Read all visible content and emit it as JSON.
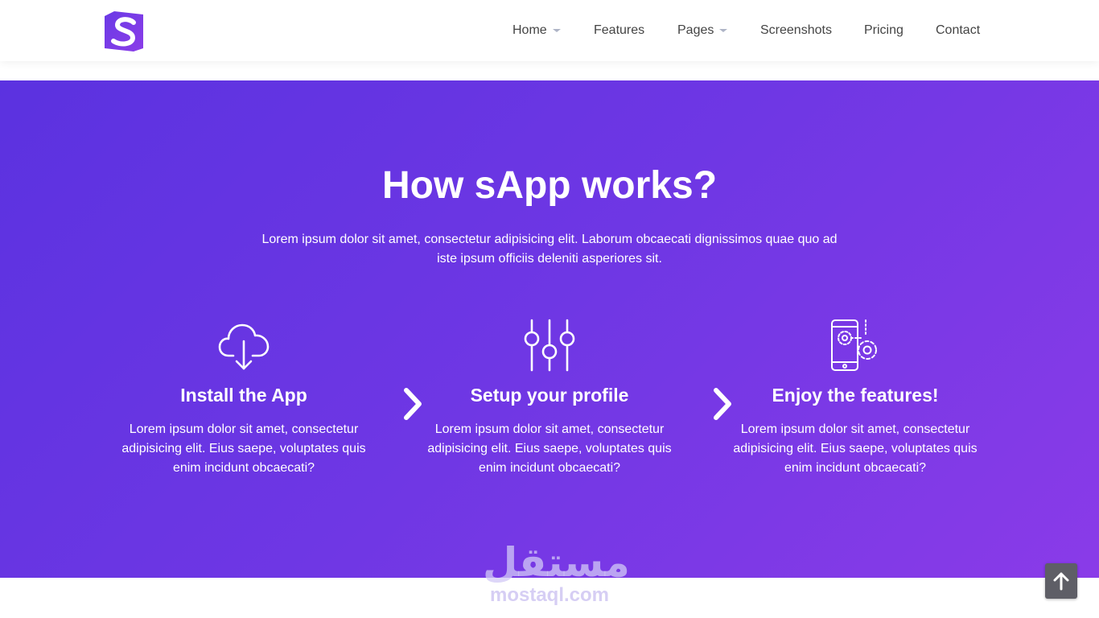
{
  "header": {
    "logo_icon": "s-logo-icon",
    "nav": {
      "home": "Home",
      "features": "Features",
      "pages": "Pages",
      "screenshots": "Screenshots",
      "pricing": "Pricing",
      "contact": "Contact"
    }
  },
  "hero": {
    "title": "How sApp works?",
    "lead": "Lorem ipsum dolor sit amet, consectetur adipisicing elit. Laborum obcaecati dignissimos quae quo ad iste ipsum officiis deleniti asperiores sit.",
    "steps": [
      {
        "icon": "cloud-download-icon",
        "title": "Install the App",
        "text": "Lorem ipsum dolor sit amet, consectetur adipisicing elit. Eius saepe, voluptates quis enim incidunt obcaecati?"
      },
      {
        "icon": "sliders-icon",
        "title": "Setup your profile",
        "text": "Lorem ipsum dolor sit amet, consectetur adipisicing elit. Eius saepe, voluptates quis enim incidunt obcaecati?"
      },
      {
        "icon": "mobile-gears-icon",
        "title": "Enjoy the features!",
        "text": "Lorem ipsum dolor sit amet, consectetur adipisicing elit. Eius saepe, voluptates quis enim incidunt obcaecati?"
      }
    ],
    "arrow_icon": "chevron-right-icon"
  },
  "watermark": {
    "arabic": "مستقل",
    "latin": "mostaql.com"
  },
  "back_to_top_icon": "arrow-up-icon",
  "colors": {
    "gradient_start": "#5b32e0",
    "gradient_end": "#8a3be8",
    "logo": "#7b3fe4",
    "nav_text": "#444444"
  }
}
